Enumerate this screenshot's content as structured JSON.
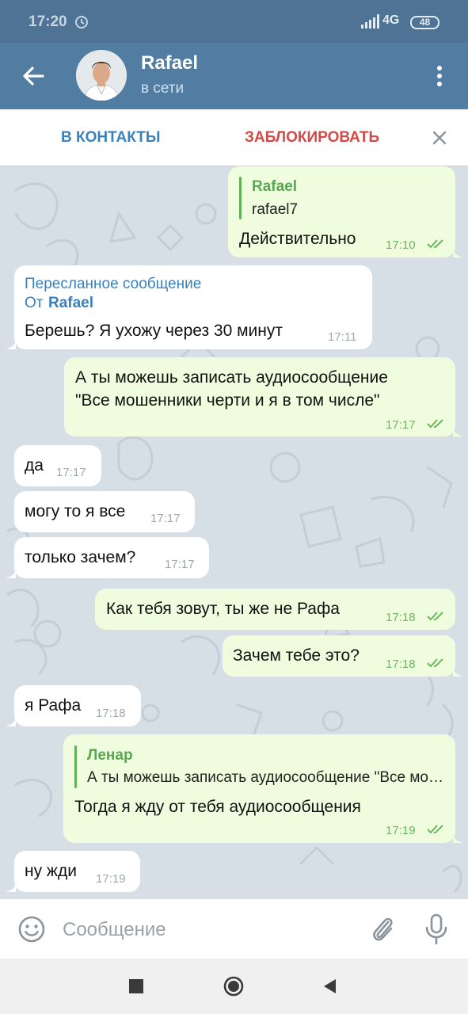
{
  "status_bar": {
    "time": "17:20",
    "network": "4G",
    "battery": "48"
  },
  "header": {
    "name": "Rafael",
    "status": "в сети"
  },
  "actions": {
    "add_contact": "В КОНТАКТЫ",
    "block": "ЗАБЛОКИРОВАТЬ"
  },
  "messages": [
    {
      "dir": "out",
      "reply_name": "Rafael",
      "reply_text": "rafael7",
      "text": "Действительно",
      "time": "17:10",
      "read": true
    },
    {
      "dir": "in",
      "forward_label": "Пересланное сообщение",
      "forward_from_prefix": "От",
      "forward_from": "Rafael",
      "text": "Берешь? Я ухожу через 30 минут",
      "time": "17:11"
    },
    {
      "dir": "out",
      "text_lines": [
        "А ты можешь записать аудиосообщение",
        "\"Все мошенники черти и я в том числе\""
      ],
      "time": "17:17",
      "read": true
    },
    {
      "dir": "in",
      "text": "да",
      "time": "17:17"
    },
    {
      "dir": "in",
      "text": "могу то я все",
      "time": "17:17"
    },
    {
      "dir": "in",
      "text": "только зачем?",
      "time": "17:17"
    },
    {
      "dir": "out",
      "text": "Как тебя зовут, ты же не Рафа",
      "time": "17:18",
      "read": true
    },
    {
      "dir": "out",
      "text": "Зачем тебе это?",
      "time": "17:18",
      "read": true
    },
    {
      "dir": "in",
      "text": "я Рафа",
      "time": "17:18"
    },
    {
      "dir": "out",
      "reply_name": "Ленар",
      "reply_text": "А ты можешь записать аудиосообщение \"Все мошенники черти и я в том числе\"",
      "text": "Тогда я жду от тебя аудиосообщения",
      "time": "17:19",
      "read": true
    },
    {
      "dir": "in",
      "text": "ну жди",
      "time": "17:19"
    }
  ],
  "input": {
    "placeholder": "Сообщение"
  },
  "colors": {
    "header": "#517da2",
    "outgoing_bubble": "#effdde",
    "incoming_bubble": "#ffffff",
    "link_blue": "#3a80bb",
    "block_red": "#d14a48"
  }
}
